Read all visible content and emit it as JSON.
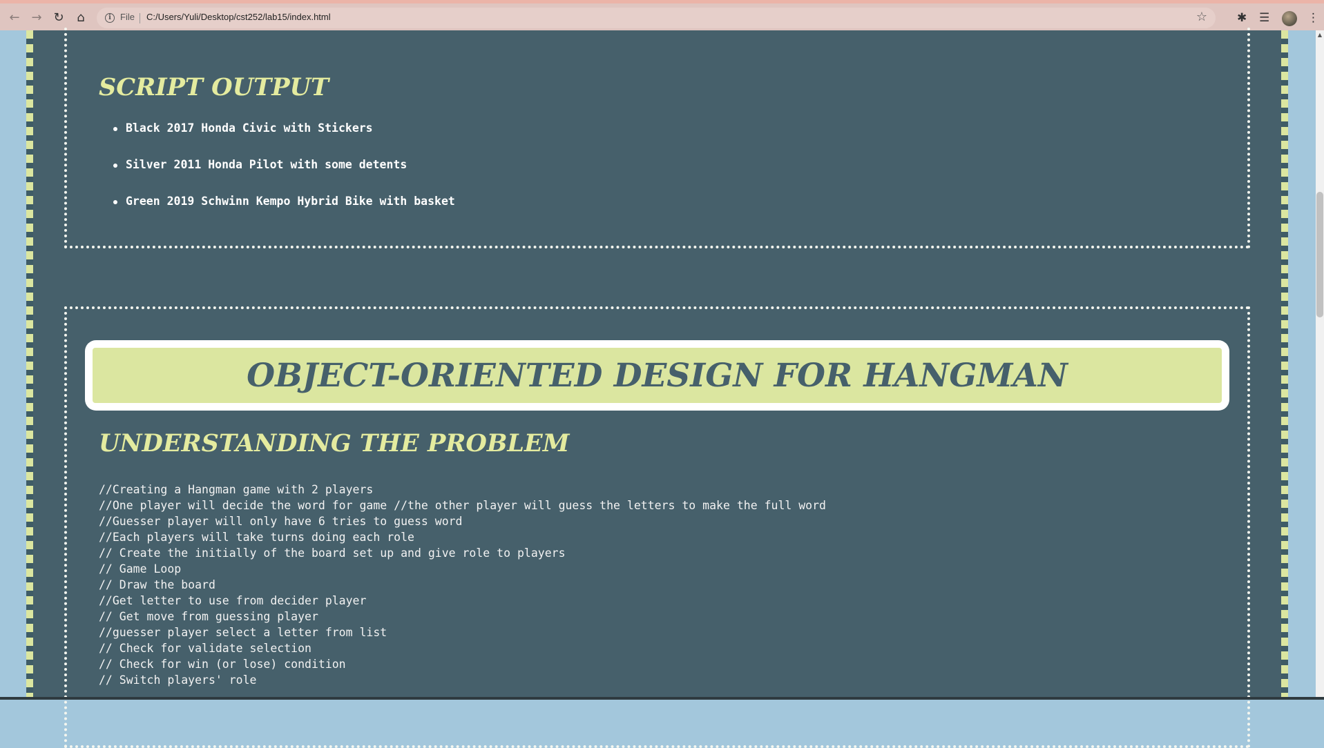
{
  "browser": {
    "file_label": "File",
    "url": "C:/Users/Yuli/Desktop/cst252/lab15/index.html",
    "icons": [
      "back-arrow-icon",
      "forward-arrow-icon",
      "reload-icon",
      "home-icon",
      "info-icon",
      "star-icon",
      "extensions-icon",
      "reading-list-icon",
      "avatar",
      "more-menu-icon"
    ]
  },
  "colors": {
    "page_bg": "#46606b",
    "accent_yellow": "#e4eb9f",
    "banner_bg": "#dbe6a0",
    "side_blue": "#a3c7dc"
  },
  "script_output": {
    "title": "SCRIPT OUTPUT",
    "items": [
      "Black 2017 Honda Civic with Stickers",
      "Silver 2011 Honda Pilot with some detents",
      "Green 2019 Schwinn Kempo Hybrid Bike with basket"
    ]
  },
  "hangman": {
    "banner": "OBJECT-ORIENTED DESIGN FOR HANGMAN",
    "subtitle": "UNDERSTANDING THE PROBLEM",
    "lines": [
      "//Creating a Hangman game with 2 players",
      "//One player will decide the word for game //the other player will guess the letters to make the full word",
      "//Guesser player will only have 6 tries to guess word",
      "//Each players will take turns doing each role",
      "// Create the initially of the board set up and give role to players",
      "// Game Loop",
      "// Draw the board",
      "//Get letter to use from decider player",
      "// Get move from guessing player",
      "//guesser player select a letter from list",
      "// Check for validate selection",
      "// Check for win (or lose) condition",
      "// Switch players' role"
    ]
  }
}
